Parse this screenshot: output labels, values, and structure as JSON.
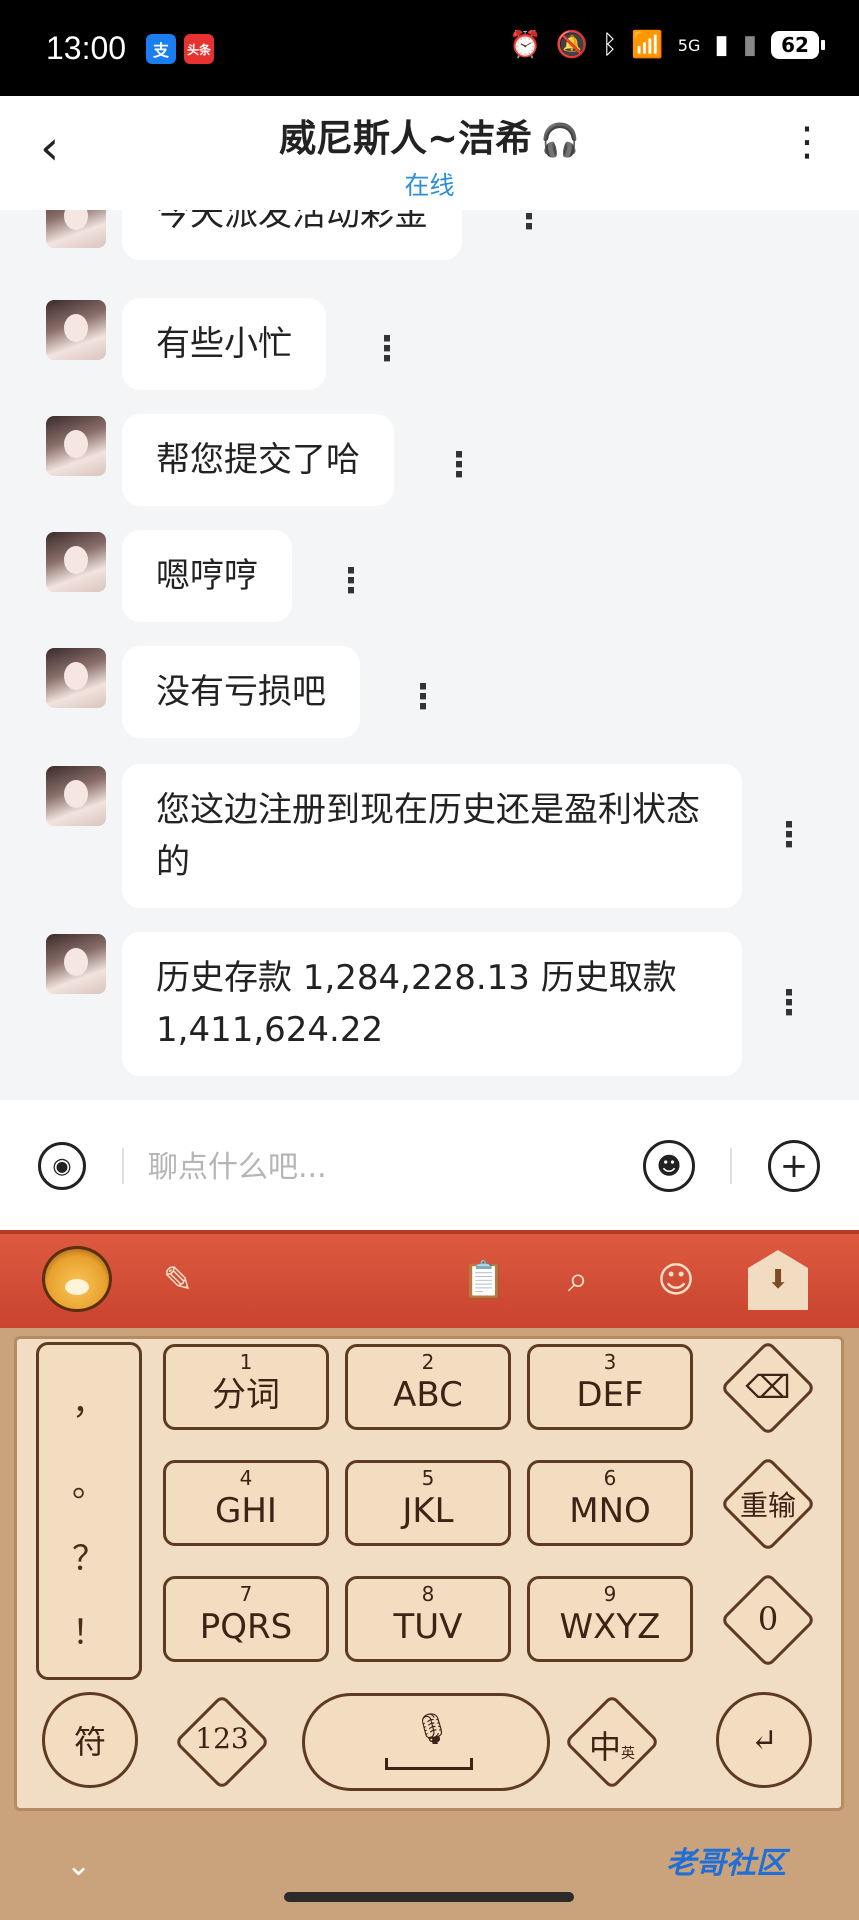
{
  "status_bar": {
    "time": "13:00",
    "apps": [
      "支",
      "头条"
    ],
    "battery": "62",
    "network": "5G"
  },
  "header": {
    "back_icon": "back-icon",
    "title": "威尼斯人~洁希",
    "subtitle": "在线",
    "more_icon": "more-vertical-icon"
  },
  "messages": [
    {
      "text": "今天派发活动彩金"
    },
    {
      "text": "有些小忙"
    },
    {
      "text": "帮您提交了哈"
    },
    {
      "text": "嗯哼哼"
    },
    {
      "text": "没有亏损吧"
    },
    {
      "text": "您这边注册到现在历史还是盈利状态的"
    },
    {
      "text": "历史存款 1,284,228.13 历史取款 1,411,624.22"
    }
  ],
  "input": {
    "placeholder": "聊点什么吧..."
  },
  "keyboard": {
    "punct": [
      "，",
      "。",
      "？",
      "！"
    ],
    "keys": [
      {
        "num": "1",
        "main": "分词"
      },
      {
        "num": "2",
        "main": "ABC"
      },
      {
        "num": "3",
        "main": "DEF"
      },
      {
        "num": "4",
        "main": "GHI"
      },
      {
        "num": "5",
        "main": "JKL"
      },
      {
        "num": "6",
        "main": "MNO"
      },
      {
        "num": "7",
        "main": "PQRS"
      },
      {
        "num": "8",
        "main": "TUV"
      },
      {
        "num": "9",
        "main": "WXYZ"
      }
    ],
    "side": {
      "delete": "⌫",
      "reenter": "重输",
      "zero": "0"
    },
    "bottom": {
      "symbol": "符",
      "numbers": "123",
      "lang": "中",
      "lang_sub": "英",
      "enter": "↵"
    }
  },
  "watermark": "老哥社区",
  "colors": {
    "accent": "#2d8fd5",
    "online_icon": "#2fb36b",
    "kb_toolbar": "#d24f37"
  }
}
